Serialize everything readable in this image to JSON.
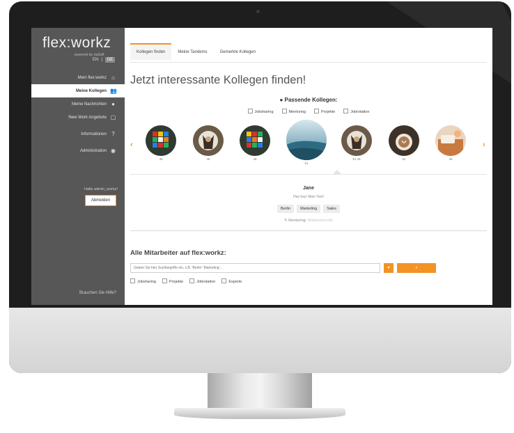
{
  "sidebar": {
    "logo": "flex:workz",
    "logo_sub": "powered by viaSoft",
    "lang": {
      "en": "EN",
      "de": "DE"
    },
    "items": [
      {
        "label": "Mein flex:workz",
        "icon": "home-icon"
      },
      {
        "label": "Meine Kollegen",
        "icon": "users-icon"
      },
      {
        "label": "Meine Nachrichten",
        "icon": "chat-icon"
      },
      {
        "label": "New Work Angebote",
        "icon": "calendar-icon"
      },
      {
        "label": "Informationen",
        "icon": "question-icon"
      },
      {
        "label": "Administration",
        "icon": "eye-icon"
      }
    ],
    "greeting": "Hallo admin_workz!",
    "logout": "Abmelden",
    "help": "Brauchen Sie Hilfe?"
  },
  "tabs": [
    "Kollegen finden",
    "Meine Tandems",
    "Gemerkte Kollegen"
  ],
  "headline": "Jetzt interessante Kollegen finden!",
  "matches": {
    "title": "Passende Kollegen:",
    "filters": [
      "Jobsharing",
      "Mentoring",
      "Projekte",
      "Jobrotation"
    ]
  },
  "carousel": {
    "labels": [
      "45",
      "46",
      "46",
      "61",
      "51 46",
      "51",
      "46"
    ]
  },
  "selected": {
    "name": "Jane",
    "quote": "Hey hey! Mein Text!",
    "tags": [
      "Berlin",
      "Marketing",
      "Sales"
    ],
    "mentoring_label": "Mentoring:",
    "mentoring_value": "Mitarbeiterrolle"
  },
  "search": {
    "title": "Alle Mitarbeiter auf flex:workz:",
    "placeholder": "Geben Sie hier Suchbegriffe ein, z.B. 'Berlin' 'Marketing'...",
    "dropdown_icon": "chevron-down-icon",
    "button_icon": "search-icon",
    "filters": [
      "Jobsharing",
      "Projekte",
      "Jobrotation",
      "Experte"
    ]
  },
  "colors": {
    "accent": "#f39324",
    "sidebar": "#575757"
  }
}
